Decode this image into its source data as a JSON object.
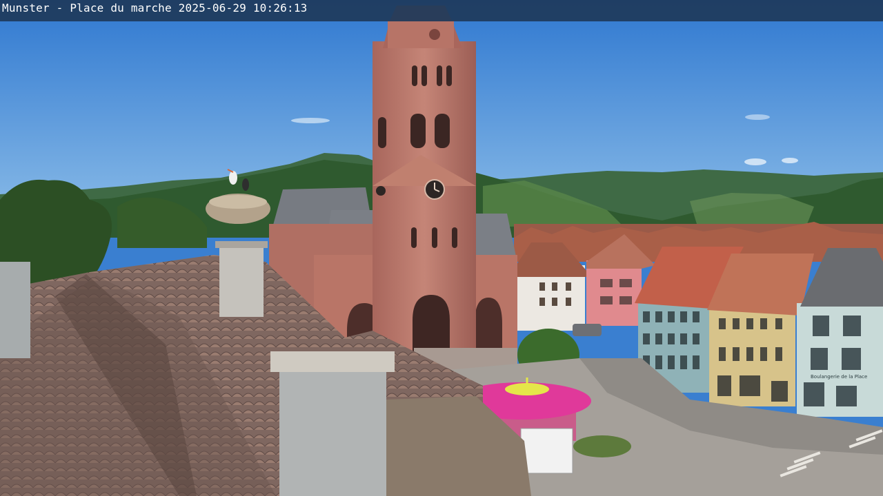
{
  "overlay": {
    "location": "Munster - Place du marche",
    "date": "2025-06-29",
    "time": "10:26:13"
  },
  "signs": {
    "shop_name": "Boulangerie de la Place"
  },
  "colors": {
    "sky_top": "#2f78d0",
    "sky_bottom": "#7fb6e6",
    "church_stone": "#b9756a",
    "roof_tiles": "#8a6a5e",
    "carousel_canopy": "#e0399a",
    "overlay_bar": "#1e3a5a"
  }
}
